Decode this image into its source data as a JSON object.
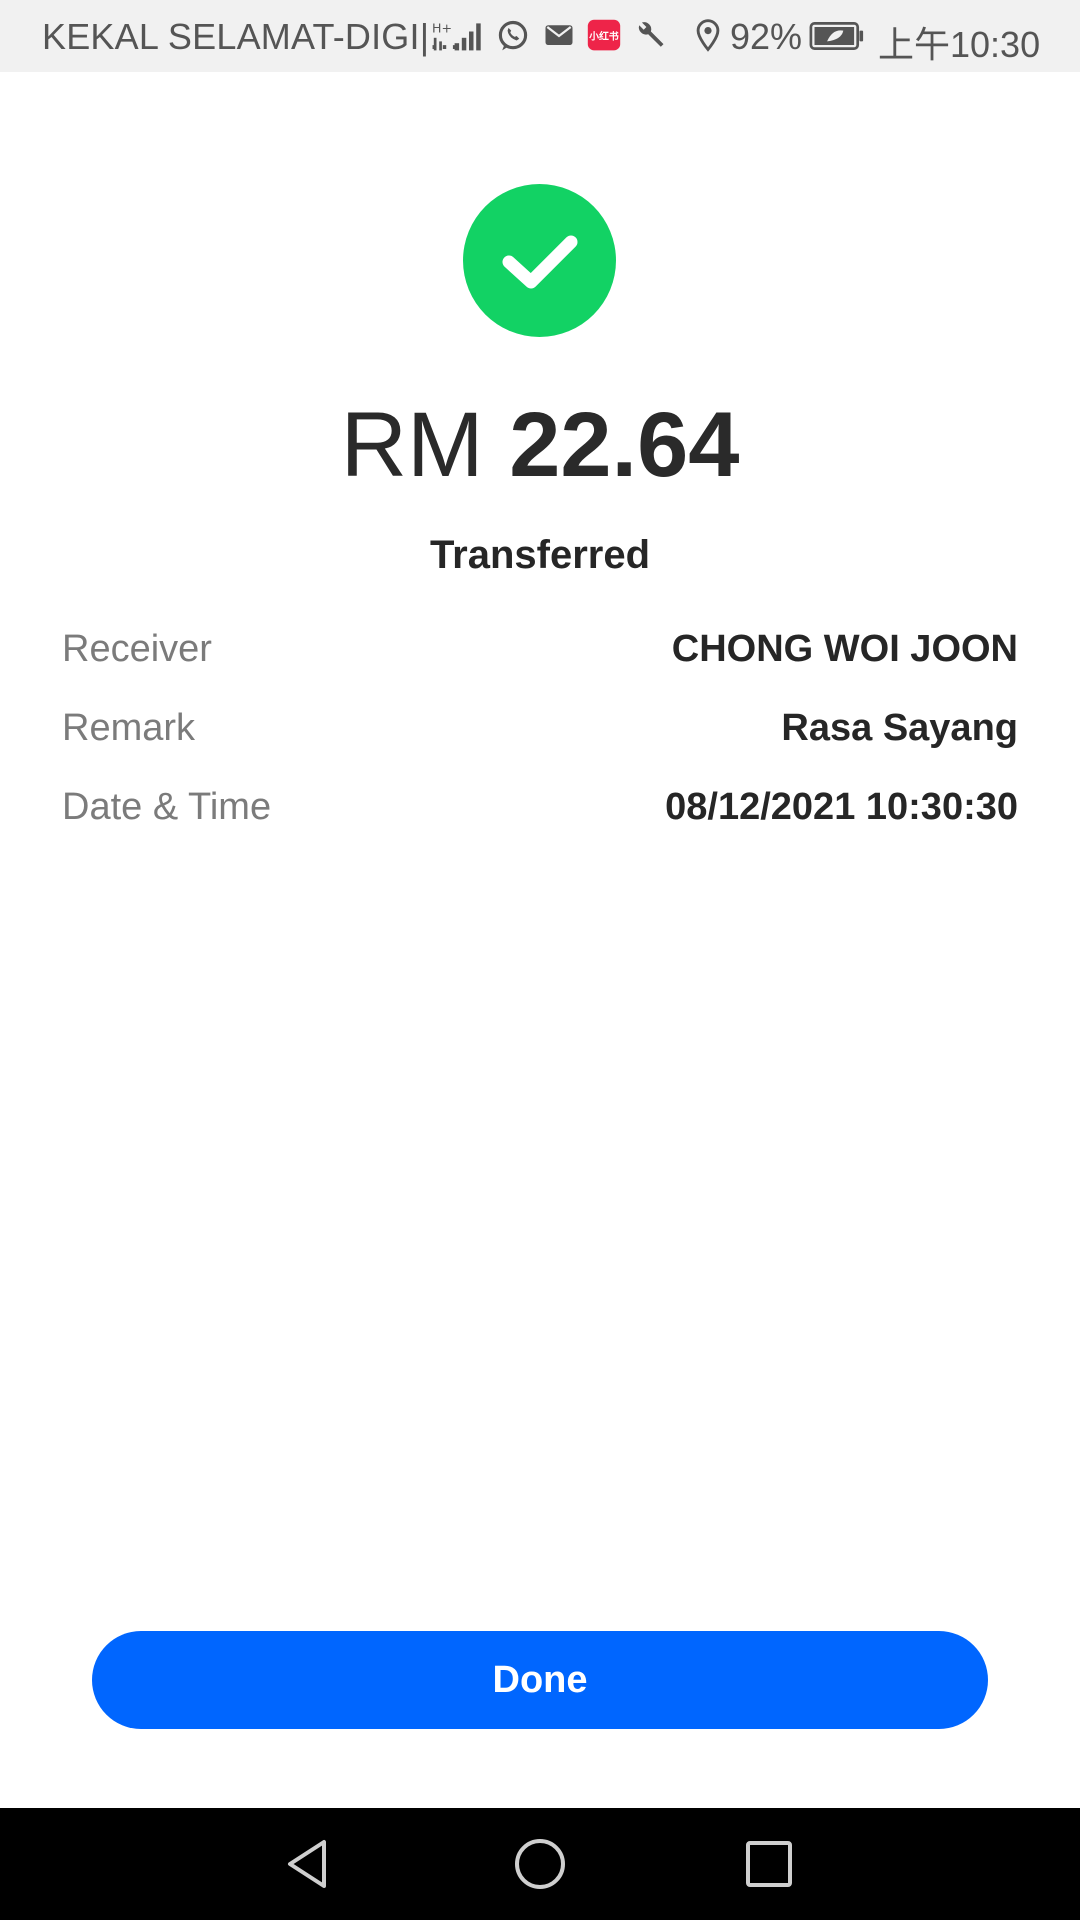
{
  "status_bar": {
    "carrier": "KEKAL SELAMAT-DIGI|...",
    "battery": "92%",
    "time": "上午10:30",
    "icons": [
      "network-h-plus-icon",
      "signal-icon",
      "whatsapp-icon",
      "mail-icon",
      "xiaohongshu-icon",
      "wrench-icon",
      "location-icon",
      "battery-icon"
    ],
    "xiaohongshu_icon_text": "小红书"
  },
  "receipt": {
    "currency": "RM",
    "amount": "22.64",
    "status": "Transferred",
    "details": [
      {
        "label": "Receiver",
        "value": "CHONG WOI JOON"
      },
      {
        "label": "Remark",
        "value": "Rasa Sayang"
      },
      {
        "label": "Date & Time",
        "value": "08/12/2021 10:30:30"
      }
    ]
  },
  "actions": {
    "done_label": "Done"
  },
  "nav": {
    "buttons": [
      "back-icon",
      "home-icon",
      "recents-icon"
    ]
  },
  "colors": {
    "success": "#12d264",
    "primary_button": "#0066ff",
    "status_bar_bg": "#f1f1f1",
    "nav_bar_bg": "#000000"
  }
}
